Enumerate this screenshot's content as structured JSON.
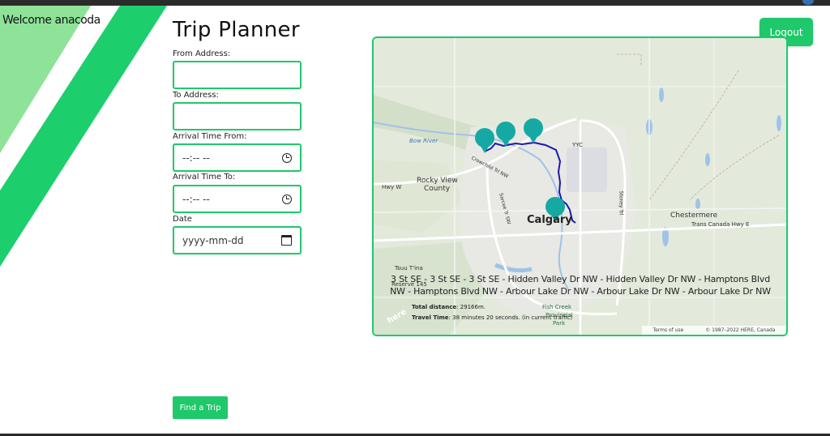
{
  "header": {
    "welcome_text": "Welcome anacoda",
    "logout_label": "Logout"
  },
  "page": {
    "title": "Trip Planner"
  },
  "form": {
    "from_label": "From Address:",
    "from_value": "",
    "to_label": "To Address:",
    "to_value": "",
    "arrival_from_label": "Arrival Time From:",
    "arrival_from_placeholder": "--:-- --",
    "arrival_to_label": "Arrival Time To:",
    "arrival_to_placeholder": "--:-- --",
    "date_label": "Date",
    "date_placeholder": "yyyy-mm-dd",
    "find_button_label": "Find a Trip"
  },
  "map": {
    "labels": {
      "city": "Calgary",
      "rocky_view_1": "Rocky View",
      "rocky_view_2": "County",
      "chestermere": "Chestermere",
      "trans_canada": "Trans Canada Hwy E",
      "airport": "YYC",
      "bow_river": "Bow River",
      "hwy_w": "Hwy W",
      "tsuu_tina": "Tsuu T'ina",
      "reserve": "Reserve 145",
      "fish_creek_1": "Fish Creek",
      "fish_creek_2": "Provincial",
      "fish_creek_3": "Park",
      "crowchild": "Crowchild Trl NW",
      "sarcee": "Sarcee Tr SW",
      "stoney": "Stoney Trl",
      "here_logo": "here"
    },
    "route_text": "3 St SE - 3 St SE - 3 St SE - Hidden Valley Dr NW - Hidden Valley Dr NW - Hamptons Blvd NW - Hamptons Blvd NW - Arbour Lake Dr NW - Arbour Lake Dr NW - Arbour Lake Dr NW",
    "distance_label": "Total distance",
    "distance_value": ": 29166m.",
    "time_label": "Travel Time",
    "time_value": ": 38 minutes 20 seconds. (in current traffic)",
    "terms": "Terms of use",
    "copyright": "© 1987–2022 HERE, Canada",
    "colors": {
      "route": "#1a1aa8",
      "marker": "#16a9a3",
      "border": "#1fc86b"
    }
  }
}
